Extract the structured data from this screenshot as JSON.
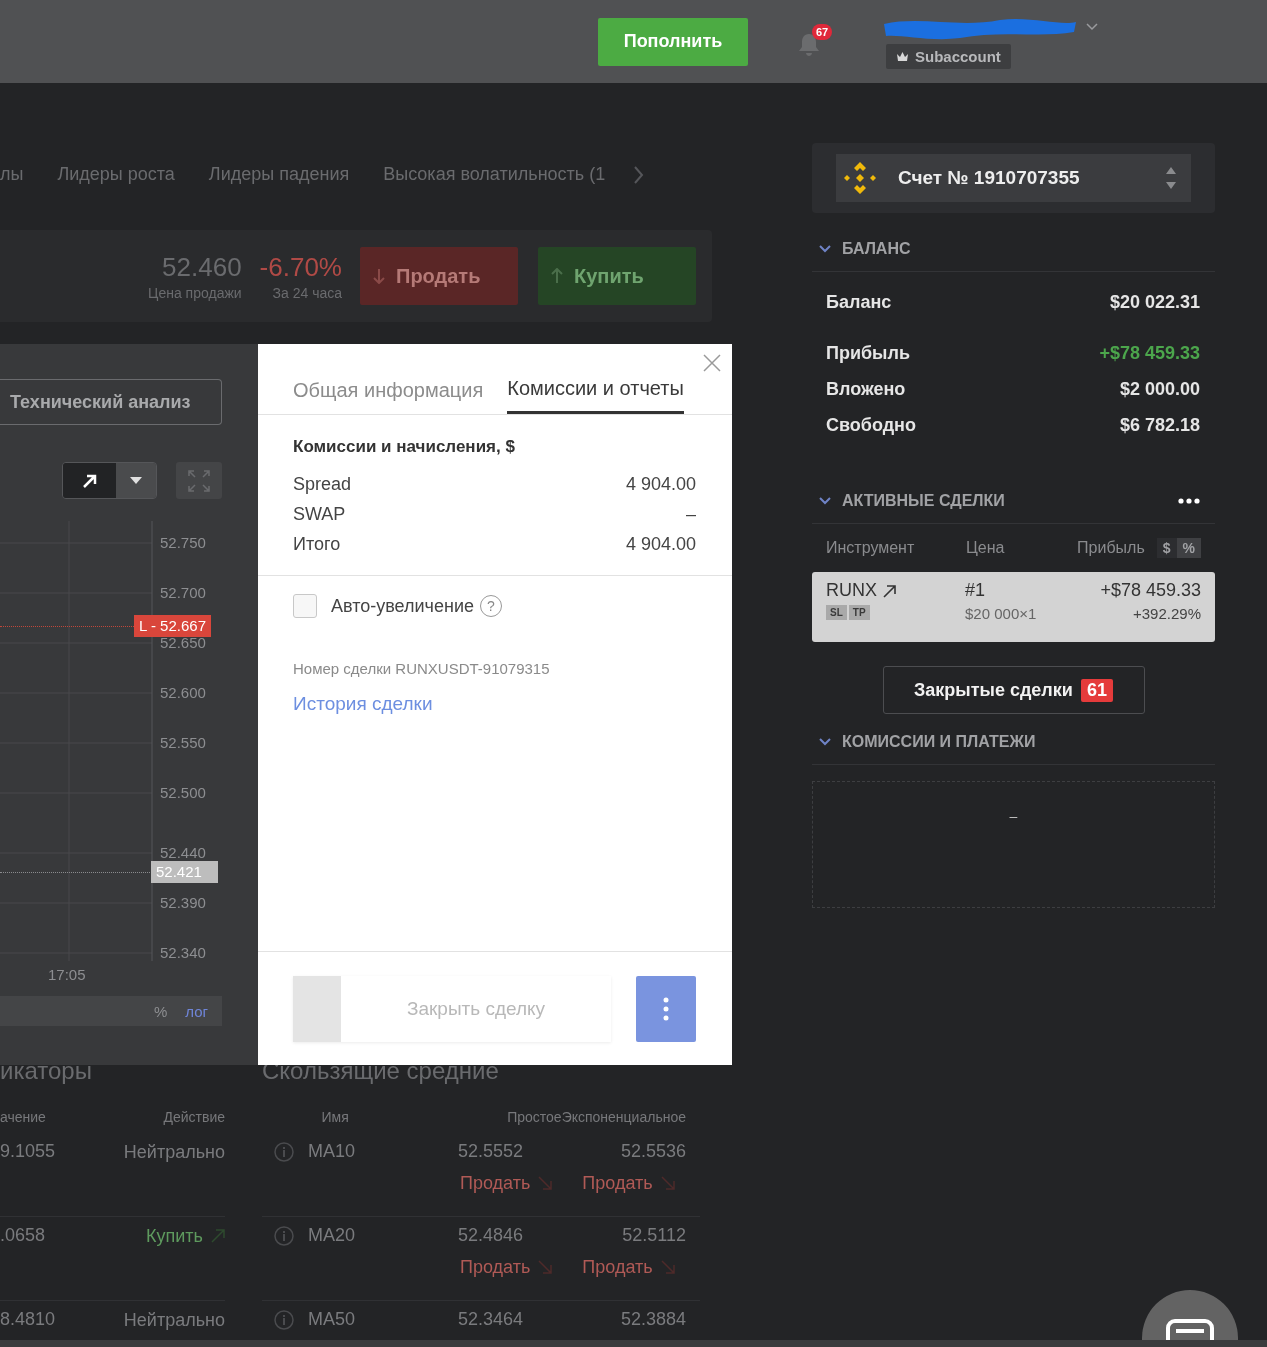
{
  "header": {
    "deposit_button": "Пополнить",
    "notifications": {
      "count": "67"
    },
    "account_tag": "Subaccount"
  },
  "market_tabs": [
    "лы",
    "Лидеры роста",
    "Лидеры падения",
    "Высокая волатильность (1"
  ],
  "quote": {
    "price": "52.460",
    "price_label": "Цена продажи",
    "change": "-6.70%",
    "change_label": "За 24 часа",
    "sell_button": "Продать",
    "buy_button": "Купить"
  },
  "chart_panel": {
    "analysis_button": "Технический анализ",
    "y_labels": [
      "52.750",
      "52.700",
      "52.650",
      "52.600",
      "52.550",
      "52.500",
      "52.440",
      "52.390",
      "52.340"
    ],
    "x_labels": [
      "17:05"
    ],
    "price_tags": [
      {
        "label": "L - 52.667",
        "kind": "order"
      },
      {
        "label": "52.421",
        "kind": "current"
      }
    ],
    "scale_buttons": [
      {
        "label": "%",
        "selected": false
      },
      {
        "label": "лог",
        "selected": true
      }
    ]
  },
  "deal_dialog": {
    "tabs": [
      {
        "label": "Общая информация",
        "selected": false
      },
      {
        "label": "Комиссии и отчеты",
        "selected": true
      }
    ],
    "fees_title": "Комиссии и начисления, $",
    "fees": [
      {
        "label": "Spread",
        "value": "4 904.00"
      },
      {
        "label": "SWAP",
        "value": "–"
      },
      {
        "label": "Итого",
        "value": "4 904.00"
      }
    ],
    "auto_increase": {
      "label": "Авто-увеличение",
      "checked": false,
      "help": "?"
    },
    "deal_number": "Номер сделки RUNXUSDT-91079315",
    "history_link": "История сделки",
    "close_button": {
      "label": "Закрыть сделку",
      "disabled": true
    }
  },
  "indicators": {
    "title": "икаторы",
    "columns": [
      "ачение",
      "Действие"
    ],
    "rows": [
      {
        "value": "9.1055",
        "action": "Нейтрально",
        "kind": "neutral"
      },
      {
        "value": ".0658",
        "action": "Купить",
        "kind": "buy"
      },
      {
        "value": "8.4810",
        "action": "Нейтрально",
        "kind": "neutral"
      }
    ]
  },
  "moving_averages": {
    "title": "Скользящие средние",
    "columns": [
      "Имя",
      "Простое",
      "Экспоненциальное"
    ],
    "rows": [
      {
        "name": "MA10",
        "simple": "52.5552",
        "exponential": "52.5536",
        "actions": [
          {
            "label": "Продать",
            "kind": "sell"
          },
          {
            "label": "Продать",
            "kind": "sell"
          }
        ]
      },
      {
        "name": "MA20",
        "simple": "52.4846",
        "exponential": "52.5112",
        "actions": [
          {
            "label": "Продать",
            "kind": "sell"
          },
          {
            "label": "Продать",
            "kind": "sell"
          }
        ]
      },
      {
        "name": "MA50",
        "simple": "52.3464",
        "exponential": "52.3884"
      }
    ]
  },
  "account": {
    "title": "Счет № 1910707355"
  },
  "balance": {
    "title": "БАЛАНС",
    "expanded": true,
    "rows": [
      {
        "label": "Баланс",
        "value": "$20 022.31",
        "color": "#e6e6e6"
      },
      {
        "label": "Прибыль",
        "value": "+$78 459.33",
        "color": "#4ca64c"
      },
      {
        "label": "Вложено",
        "value": "$2 000.00",
        "color": "#e6e6e6"
      },
      {
        "label": "Свободно",
        "value": "$6 782.18",
        "color": "#e6e6e6"
      }
    ]
  },
  "active_deals": {
    "title": "АКТИВНЫЕ СДЕЛКИ",
    "expanded": true,
    "columns": [
      "Инструмент",
      "Цена",
      "Прибыль"
    ],
    "units": [
      {
        "label": "$",
        "selected": true
      },
      {
        "label": "%",
        "selected": false
      }
    ],
    "rows": [
      {
        "symbol": "RUNX",
        "tags": [
          "SL",
          "TP"
        ],
        "number": "#1",
        "amount": "$20 000×1",
        "profit": "+$78 459.33",
        "profit_percent": "+392.29%"
      }
    ]
  },
  "closed_deals_button": {
    "label": "Закрытые сделки",
    "count": "61"
  },
  "payments": {
    "title": "КОМИССИИ И ПЛАТЕЖИ",
    "expanded": true,
    "empty_text": "–"
  }
}
